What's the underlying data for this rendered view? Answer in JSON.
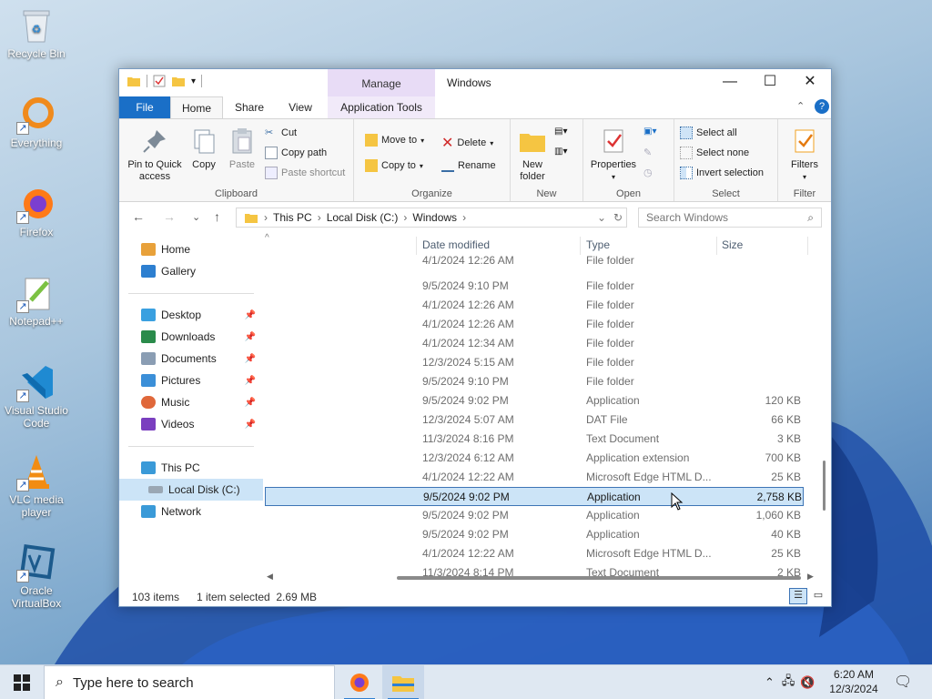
{
  "desktop": {
    "icons": [
      {
        "label": "Recycle Bin"
      },
      {
        "label": "Everything"
      },
      {
        "label": "Firefox"
      },
      {
        "label": "Notepad++"
      },
      {
        "label": "Visual Studio Code"
      },
      {
        "label": "VLC media player"
      },
      {
        "label": "Oracle VirtualBox"
      }
    ]
  },
  "window": {
    "title": "Windows",
    "manage_tab": "Manage",
    "tabs": {
      "file": "File",
      "home": "Home",
      "share": "Share",
      "view": "View",
      "app_tools": "Application Tools"
    },
    "ribbon": {
      "clipboard": {
        "label": "Clipboard",
        "pin": "Pin to Quick access",
        "copy": "Copy",
        "paste": "Paste",
        "cut": "Cut",
        "copy_path": "Copy path",
        "paste_shortcut": "Paste shortcut"
      },
      "organize": {
        "label": "Organize",
        "move_to": "Move to",
        "copy_to": "Copy to",
        "delete": "Delete",
        "rename": "Rename"
      },
      "new": {
        "label": "New",
        "new_folder": "New folder"
      },
      "open": {
        "label": "Open",
        "properties": "Properties"
      },
      "select": {
        "label": "Select",
        "select_all": "Select all",
        "select_none": "Select none",
        "invert": "Invert selection"
      },
      "filter": {
        "label": "Filter",
        "filters": "Filters"
      }
    },
    "address": {
      "crumbs": [
        "This PC",
        "Local Disk (C:)",
        "Windows"
      ],
      "search_placeholder": "Search Windows"
    },
    "nav": {
      "home": "Home",
      "gallery": "Gallery",
      "desktop": "Desktop",
      "downloads": "Downloads",
      "documents": "Documents",
      "pictures": "Pictures",
      "music": "Music",
      "videos": "Videos",
      "this_pc": "This PC",
      "local_disk": "Local Disk (C:)",
      "network": "Network"
    },
    "columns": {
      "date": "Date modified",
      "type": "Type",
      "size": "Size"
    },
    "rows": [
      {
        "date": "4/1/2024 12:26 AM",
        "type": "File folder",
        "size": ""
      },
      {
        "date": "9/5/2024 9:10 PM",
        "type": "File folder",
        "size": ""
      },
      {
        "date": "4/1/2024 12:26 AM",
        "type": "File folder",
        "size": ""
      },
      {
        "date": "4/1/2024 12:26 AM",
        "type": "File folder",
        "size": ""
      },
      {
        "date": "4/1/2024 12:34 AM",
        "type": "File folder",
        "size": ""
      },
      {
        "date": "12/3/2024 5:15 AM",
        "type": "File folder",
        "size": ""
      },
      {
        "date": "9/5/2024 9:10 PM",
        "type": "File folder",
        "size": ""
      },
      {
        "date": "9/5/2024 9:02 PM",
        "type": "Application",
        "size": "120 KB"
      },
      {
        "date": "12/3/2024 5:07 AM",
        "type": "DAT File",
        "size": "66 KB"
      },
      {
        "date": "11/3/2024 8:16 PM",
        "type": "Text Document",
        "size": "3 KB"
      },
      {
        "date": "12/3/2024 6:12 AM",
        "type": "Application extension",
        "size": "700 KB"
      },
      {
        "date": "4/1/2024 12:22 AM",
        "type": "Microsoft Edge HTML D...",
        "size": "25 KB"
      },
      {
        "date": "9/5/2024 9:02 PM",
        "type": "Application",
        "size": "2,758 KB"
      },
      {
        "date": "9/5/2024 9:02 PM",
        "type": "Application",
        "size": "1,060 KB"
      },
      {
        "date": "9/5/2024 9:02 PM",
        "type": "Application",
        "size": "40 KB"
      },
      {
        "date": "4/1/2024 12:22 AM",
        "type": "Microsoft Edge HTML D...",
        "size": "25 KB"
      },
      {
        "date": "11/3/2024 8:14 PM",
        "type": "Text Document",
        "size": "2 KB"
      }
    ],
    "selected_row_index": 12,
    "status": {
      "count": "103 items",
      "selection": "1 item selected  2.69 MB"
    }
  },
  "taskbar": {
    "search_placeholder": "Type here to search",
    "time": "6:20 AM",
    "date": "12/3/2024"
  }
}
